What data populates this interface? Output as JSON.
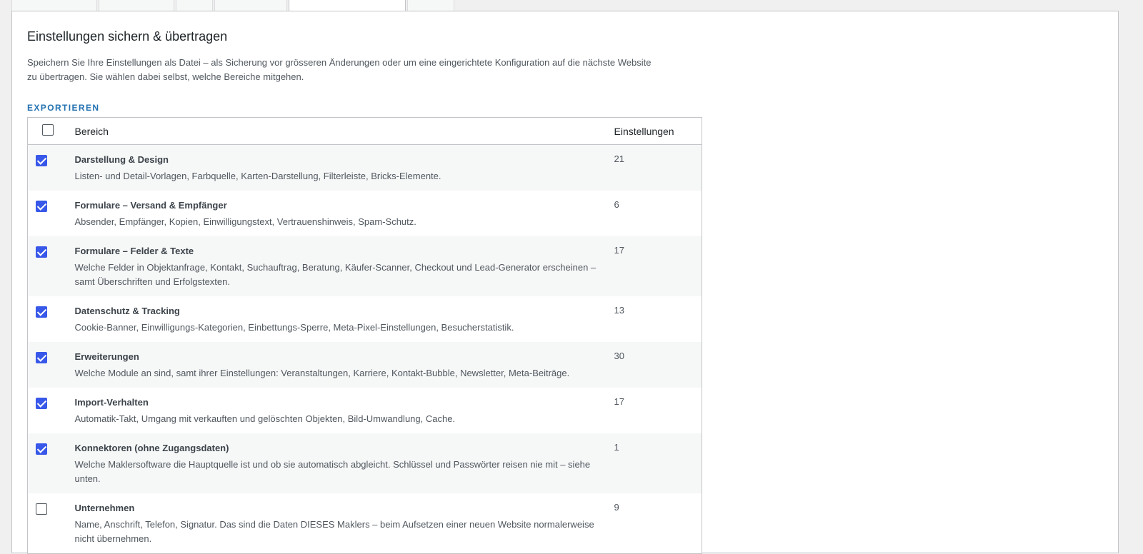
{
  "panel": {
    "title": "Einstellungen sichern & übertragen",
    "description": "Speichern Sie Ihre Einstellungen als Datei – als Sicherung vor grösseren Änderungen oder um eine eingerichtete Konfiguration auf die nächste Website zu übertragen. Sie wählen dabei selbst, welche Bereiche mitgehen."
  },
  "export": {
    "heading": "EXPORTIEREN",
    "columns": {
      "area": "Bereich",
      "count": "Einstellungen"
    },
    "select_all_checked": false,
    "rows": [
      {
        "title": "Darstellung & Design",
        "description": "Listen- und Detail-Vorlagen, Farbquelle, Karten-Darstellung, Filterleiste, Bricks-Elemente.",
        "count": "21",
        "checked": true
      },
      {
        "title": "Formulare – Versand & Empfänger",
        "description": "Absender, Empfänger, Kopien, Einwilligungstext, Vertrauenshinweis, Spam-Schutz.",
        "count": "6",
        "checked": true
      },
      {
        "title": "Formulare – Felder & Texte",
        "description": "Welche Felder in Objektanfrage, Kontakt, Suchauftrag, Beratung, Käufer-Scanner, Checkout und Lead-Generator erscheinen – samt Überschriften und Erfolgstexten.",
        "count": "17",
        "checked": true
      },
      {
        "title": "Datenschutz & Tracking",
        "description": "Cookie-Banner, Einwilligungs-Kategorien, Einbettungs-Sperre, Meta-Pixel-Einstellungen, Besucherstatistik.",
        "count": "13",
        "checked": true
      },
      {
        "title": "Erweiterungen",
        "description": "Welche Module an sind, samt ihrer Einstellungen: Veranstaltungen, Karriere, Kontakt-Bubble, Newsletter, Meta-Beiträge.",
        "count": "30",
        "checked": true
      },
      {
        "title": "Import-Verhalten",
        "description": "Automatik-Takt, Umgang mit verkauften und gelöschten Objekten, Bild-Umwandlung, Cache.",
        "count": "17",
        "checked": true
      },
      {
        "title": "Konnektoren (ohne Zugangsdaten)",
        "description": "Welche Maklersoftware die Hauptquelle ist und ob sie automatisch abgleicht. Schlüssel und Passwörter reisen nie mit – siehe unten.",
        "count": "1",
        "checked": true
      },
      {
        "title": "Unternehmen",
        "description": "Name, Anschrift, Telefon, Signatur. Das sind die Daten DIESES Maklers – beim Aufsetzen einer neuen Website normalerweise nicht übernehmen.",
        "count": "9",
        "checked": false
      }
    ]
  },
  "colors": {
    "accent": "#3858e9",
    "heading_blue": "#2271b1",
    "row_stripe": "#f6f7f7"
  }
}
